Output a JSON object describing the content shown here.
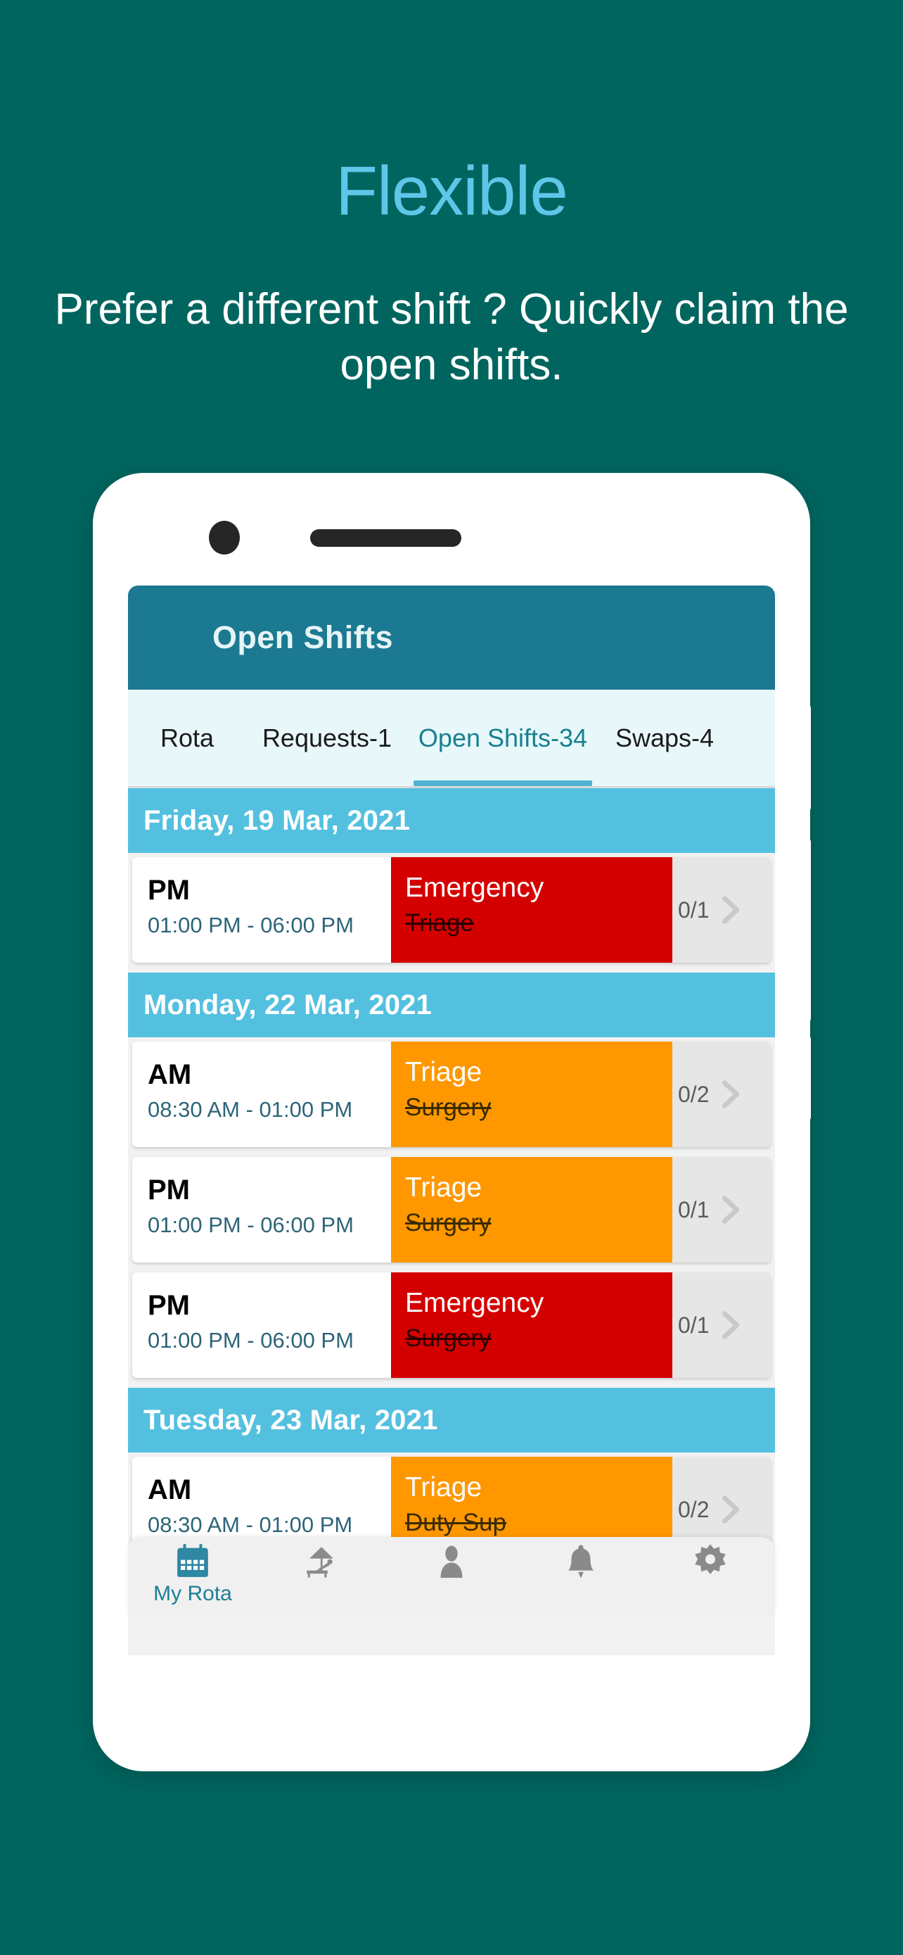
{
  "promo": {
    "title": "Flexible",
    "subtitle": "Prefer a different shift ? Quickly claim the open shifts."
  },
  "colors": {
    "background": "#00655F",
    "title_accent": "#5EC6E8",
    "appbar": "#1B7A91",
    "tab_active": "#18808F",
    "date_header": "#54C0E0",
    "shift_red": "#D40000",
    "shift_orange": "#FF9800",
    "nav_active": "#1C7E96"
  },
  "app": {
    "header": {
      "title": "Open Shifts"
    },
    "tabs": [
      {
        "label": "Rota",
        "active": false
      },
      {
        "label": "Requests-1",
        "active": false
      },
      {
        "label": "Open Shifts-34",
        "active": true
      },
      {
        "label": "Swaps-4",
        "active": false
      }
    ],
    "groups": [
      {
        "date": "Friday, 19 Mar, 2021",
        "shifts": [
          {
            "period": "PM",
            "time": "01:00 PM - 06:00 PM",
            "role": "Emergency",
            "department": "Triage",
            "color": "red",
            "count": "0/1"
          }
        ]
      },
      {
        "date": "Monday, 22 Mar, 2021",
        "shifts": [
          {
            "period": "AM",
            "time": "08:30 AM - 01:00 PM",
            "role": "Triage",
            "department": "Surgery",
            "color": "orange",
            "count": "0/2"
          },
          {
            "period": "PM",
            "time": "01:00 PM - 06:00 PM",
            "role": "Triage",
            "department": "Surgery",
            "color": "orange",
            "count": "0/1"
          },
          {
            "period": "PM",
            "time": "01:00 PM - 06:00 PM",
            "role": "Emergency",
            "department": "Surgery",
            "color": "red",
            "count": "0/1"
          }
        ]
      },
      {
        "date": "Tuesday, 23 Mar, 2021",
        "shifts": [
          {
            "period": "AM",
            "time": "08:30 AM - 01:00 PM",
            "role": "Triage",
            "department": "Duty Sup",
            "color": "orange",
            "count": "0/2"
          }
        ]
      }
    ],
    "bottom_nav": [
      {
        "icon": "calendar-icon",
        "label": "My Rota",
        "active": true
      },
      {
        "icon": "beach-leave-icon",
        "label": "",
        "active": false
      },
      {
        "icon": "person-icon",
        "label": "",
        "active": false
      },
      {
        "icon": "bell-icon",
        "label": "",
        "active": false
      },
      {
        "icon": "gear-icon",
        "label": "",
        "active": false
      }
    ]
  }
}
